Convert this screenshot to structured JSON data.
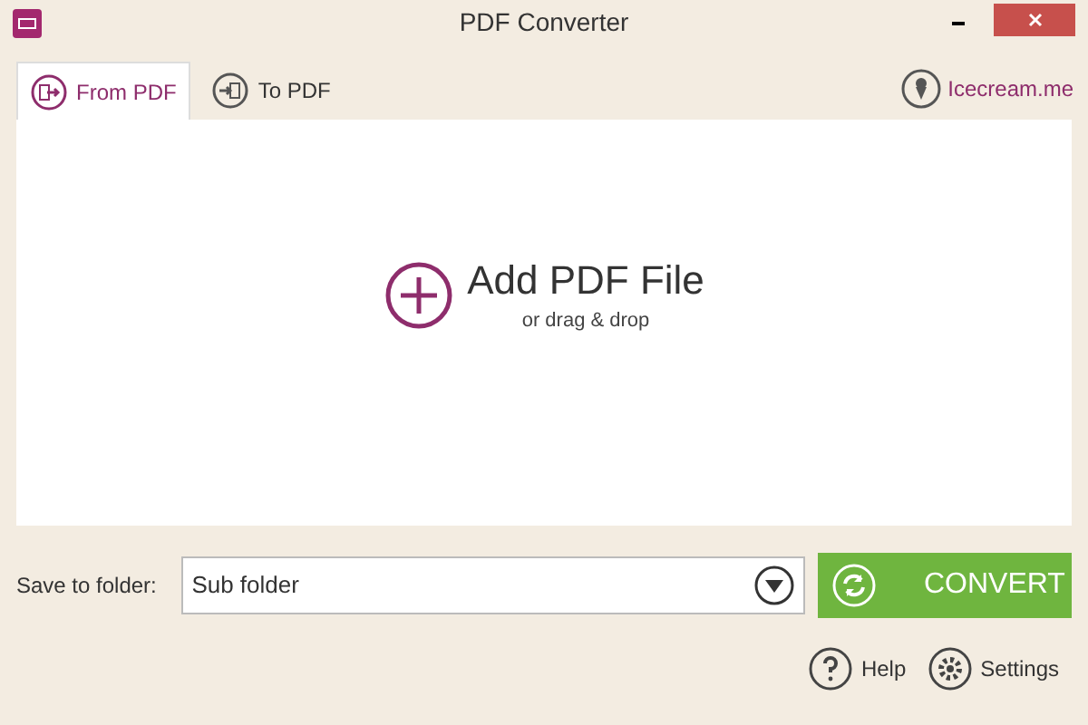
{
  "window": {
    "title": "PDF Converter"
  },
  "tabs": [
    {
      "label": "From PDF",
      "selected": true,
      "kind": "from"
    },
    {
      "label": "To PDF",
      "selected": false,
      "kind": "to"
    }
  ],
  "brand_link": "Icecream.me",
  "drop_zone": {
    "title": "Add PDF File",
    "subtitle": "or drag & drop"
  },
  "save_to": {
    "label": "Save to folder:",
    "value": "Sub folder"
  },
  "convert_button": "CONVERT",
  "footer_links": [
    {
      "label": "Help",
      "kind": "help"
    },
    {
      "label": "Settings",
      "kind": "settings"
    }
  ]
}
